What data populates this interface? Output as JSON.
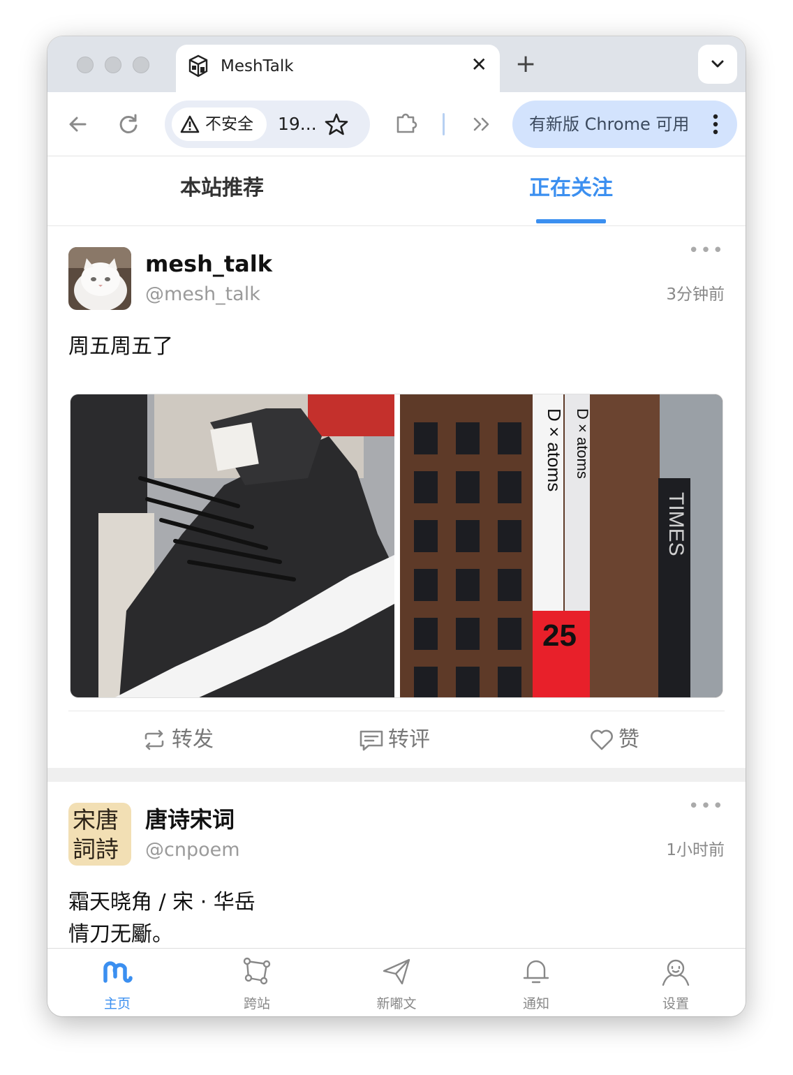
{
  "browser": {
    "tab_title": "MeshTalk",
    "tab_close": "✕",
    "new_tab": "+",
    "security_label": "不安全",
    "url": "19...",
    "update_label": "有新版 Chrome 可用"
  },
  "app_tabs": [
    {
      "label": "本站推荐",
      "active": false
    },
    {
      "label": "正在关注",
      "active": true
    }
  ],
  "accent_color": "#3b8ff0",
  "posts": [
    {
      "display_name": "mesh_talk",
      "handle": "@mesh_talk",
      "time": "3分钟前",
      "more": "•••",
      "text": "周五周五了",
      "actions": {
        "repost": "转发",
        "comment": "转评",
        "like": "赞"
      }
    },
    {
      "display_name": "唐诗宋词",
      "handle": "@cnpoem",
      "time": "1小时前",
      "more": "•••",
      "avatar_lines": [
        "宋唐",
        "詞詩"
      ],
      "text": "霜天晓角 / 宋 · 华岳\n情刀无斸。"
    }
  ],
  "bottom_nav": [
    {
      "label": "主页",
      "icon": "meshtalk-logo-icon",
      "active": true
    },
    {
      "label": "跨站",
      "icon": "federation-icon",
      "active": false
    },
    {
      "label": "新嘟文",
      "icon": "paper-plane-icon",
      "active": false
    },
    {
      "label": "通知",
      "icon": "bell-icon",
      "active": false
    },
    {
      "label": "设置",
      "icon": "user-settings-icon",
      "active": false
    }
  ]
}
